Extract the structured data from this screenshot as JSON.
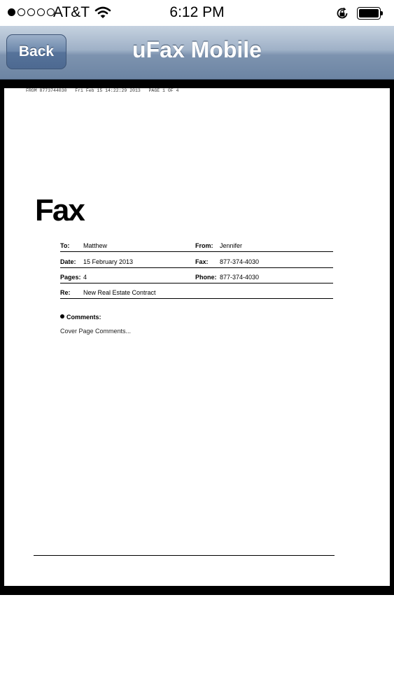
{
  "status_bar": {
    "carrier": "AT&T",
    "time": "6:12 PM",
    "signal_strength": 1,
    "signal_dots": 5
  },
  "nav": {
    "back_label": "Back",
    "title": "uFax Mobile"
  },
  "fax": {
    "header_line": "FROM 8773744030   Fri Feb 15 14:22:29 2013   PAGE 1 OF 4",
    "logo": "Fax",
    "to_label": "To:",
    "to_value": "Matthew",
    "from_label": "From:",
    "from_value": "Jennifer",
    "date_label": "Date:",
    "date_value": "15 February 2013",
    "fax_label": "Fax:",
    "fax_value": "877-374-4030",
    "pages_label": "Pages:",
    "pages_value": "4",
    "phone_label": "Phone:",
    "phone_value": "877-374-4030",
    "re_label": "Re:",
    "re_value": "New Real Estate Contract",
    "comments_label": "Comments:",
    "comments_text": "Cover Page Comments..."
  },
  "icons": {
    "wifi": "wifi-icon",
    "rotation_lock": "rotation-lock-icon",
    "battery": "battery-icon"
  }
}
